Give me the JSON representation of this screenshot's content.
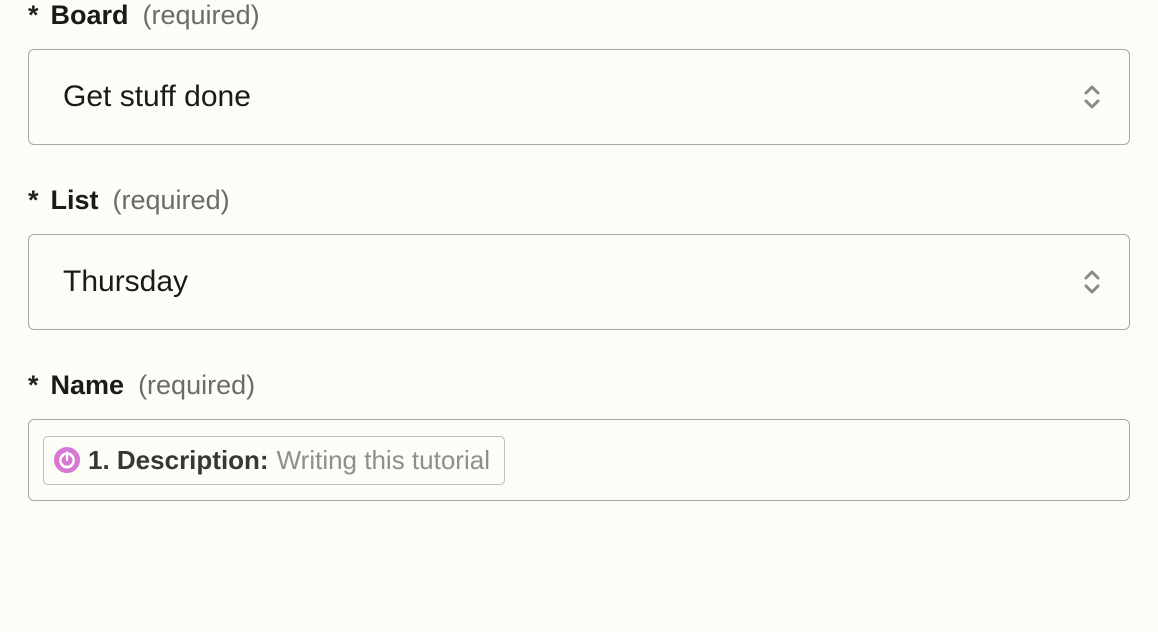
{
  "fields": {
    "board": {
      "asterisk": "*",
      "label": "Board",
      "required": "(required)",
      "value": "Get stuff done"
    },
    "list": {
      "asterisk": "*",
      "label": "List",
      "required": "(required)",
      "value": "Thursday"
    },
    "name": {
      "asterisk": "*",
      "label": "Name",
      "required": "(required)",
      "token": {
        "icon": "power-icon",
        "strong": "1. Description:",
        "light": "Writing this tutorial"
      }
    }
  }
}
